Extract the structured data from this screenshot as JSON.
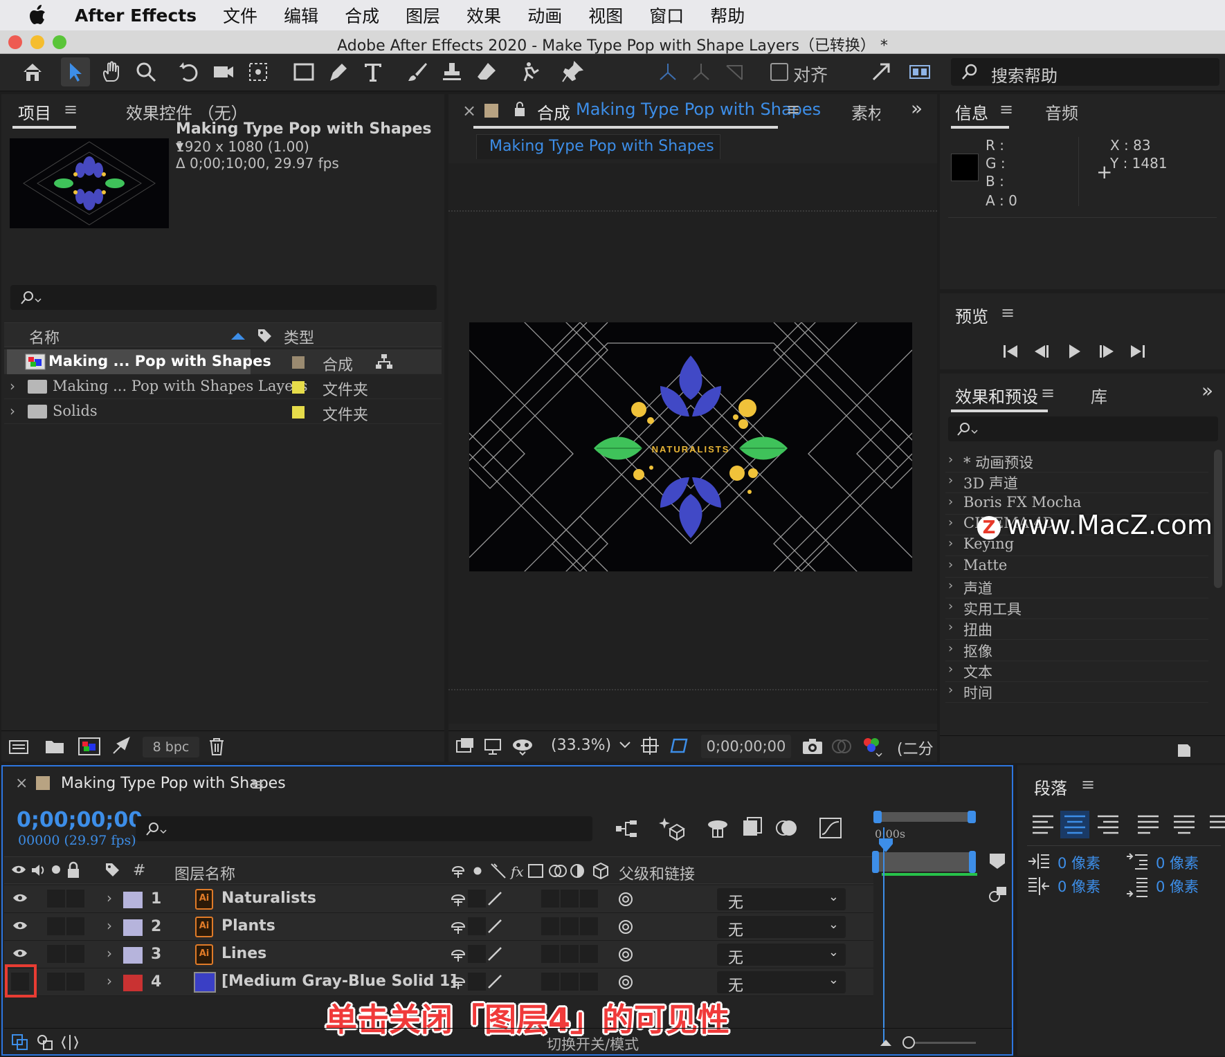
{
  "menubar": {
    "app_name": "After Effects",
    "items": [
      "文件",
      "编辑",
      "合成",
      "图层",
      "效果",
      "动画",
      "视图",
      "窗口",
      "帮助"
    ]
  },
  "window": {
    "title": "Adobe After Effects 2020 - Make Type Pop with Shape Layers（已转换） *"
  },
  "toolbar": {
    "snap_label": "对齐",
    "help_search_placeholder": "搜索帮助"
  },
  "project_panel": {
    "tab_project": "项目",
    "tab_effect_controls": "效果控件 （无）",
    "comp_title": "Making Type Pop with Shapes ▾",
    "comp_size": "1920 x 1080 (1.00)",
    "comp_duration": "Δ 0;00;10;00, 29.97 fps",
    "col_name": "名称",
    "col_type": "类型",
    "items": [
      {
        "name": "Making ... Pop with Shapes",
        "type": "合成",
        "swatch": "#9a8a70"
      },
      {
        "name": "Making ... Pop with Shapes Layers",
        "type": "文件夹",
        "swatch": "#e6dc4a"
      },
      {
        "name": "Solids",
        "type": "文件夹",
        "swatch": "#e6dc4a"
      }
    ],
    "bpc": "8 bpc"
  },
  "comp_panel": {
    "tab_prefix": "合成",
    "tab_name": "Making Type Pop with Shapes",
    "tab_footage": "素材",
    "name_tab": "Making Type Pop with Shapes",
    "artwork_text": "NATURALISTS",
    "zoom": "(33.3%)",
    "timecode": "0;00;00;00",
    "resolution": "(二分"
  },
  "info_panel": {
    "tab_info": "信息",
    "tab_audio": "音频",
    "r": "R :",
    "g": "G :",
    "b": "B :",
    "a": "A :  0",
    "x": "X : 83",
    "y": "Y : 1481"
  },
  "preview_panel": {
    "title": "预览"
  },
  "effects_panel": {
    "tab_effects": "效果和预设",
    "tab_library": "库",
    "items": [
      "* 动画预设",
      "3D 声道",
      "Boris FX Mocha",
      "CINEMA 4D",
      "Keying",
      "Matte",
      "声道",
      "实用工具",
      "扭曲",
      "抠像",
      "文本",
      "时间"
    ],
    "watermark": "www.MacZ.com",
    "watermark_logo": "Z"
  },
  "timeline_panel": {
    "comp_name": "Making Type Pop with Shapes",
    "timecode": "0;00;00;00",
    "fps": "00000 (29.97 fps)",
    "col_num": "#",
    "col_layer_name": "图层名称",
    "col_parent": "父级和链接",
    "ruler_label": "0:00s",
    "layers": [
      {
        "num": "1",
        "name": "Naturalists",
        "parent": "无",
        "label_color": "#b6b4dc",
        "bar_color": "#7c7e96",
        "visible": true
      },
      {
        "num": "2",
        "name": "Plants",
        "parent": "无",
        "label_color": "#b6b4dc",
        "bar_color": "#7c7e96",
        "visible": true
      },
      {
        "num": "3",
        "name": "Lines",
        "parent": "无",
        "label_color": "#b6b4dc",
        "bar_color": "#7c7e96",
        "visible": true
      },
      {
        "num": "4",
        "name": "[Medium Gray-Blue Solid 1]",
        "parent": "无",
        "label_color": "#c93232",
        "bar_color": "#7d3535",
        "visible": false
      }
    ],
    "caption": "单击关闭「图层4」的可见性",
    "toggle_label": "切换开关/模式"
  },
  "paragraph_panel": {
    "title": "段落",
    "indent_left": "0 像素",
    "indent_right": "0 像素",
    "space_before": "0 像素",
    "space_after": "0 像素"
  },
  "colors": {
    "accent_blue": "#3d8ee8",
    "highlight_red": "#e83c33",
    "panel_bg": "#232323"
  }
}
